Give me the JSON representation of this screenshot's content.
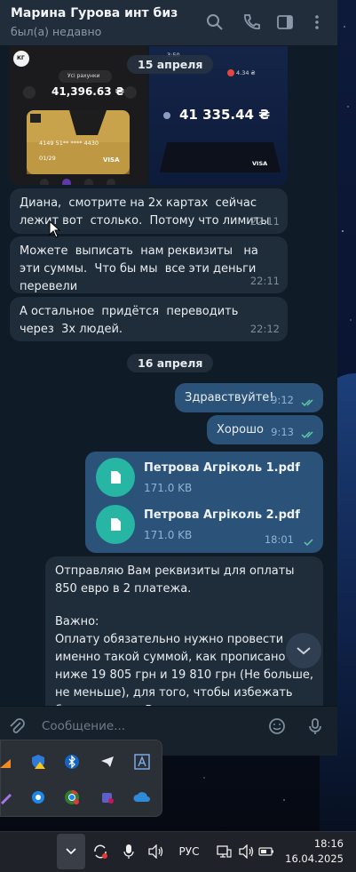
{
  "chat": {
    "contact_name": "Марина Гурова инт биз",
    "status": "был(а) недавно",
    "date_separator_1": "15 апреля",
    "date_separator_2": "16 апреля"
  },
  "images": {
    "left": {
      "bank_badge": "КГ",
      "account_pill": "Усі рахунки",
      "balance": "41,396.63 ₴",
      "card_number": "4149 51** **** 4430",
      "card_expiry": "01/29",
      "card_brand": "VISA"
    },
    "right": {
      "time": "3:50",
      "balance_small": "4.34 ₴",
      "balance": "41 335.44 ₴",
      "card_brand": "VISA"
    }
  },
  "messages": [
    {
      "text": "Диана,  смотрите на 2х картах  сейчас  лежит вот  столько.  Потому что лимиты",
      "time": "22:11"
    },
    {
      "text": "Можете  выписать  нам реквизиты   на эти суммы.  Что бы мы  все эти деньги  перевели",
      "time": "22:11"
    },
    {
      "text": "А остальное  придётся  переводить   через  3х людей.",
      "time": "22:12"
    },
    {
      "text": "Здравствуйте!",
      "time": "9:12"
    },
    {
      "text": "Хорошо",
      "time": "9:13"
    }
  ],
  "files": {
    "items": [
      {
        "name": "Петрова Агріколь 1.pdf",
        "size": "171.0 KB"
      },
      {
        "name": "Петрова Агріколь 2.pdf",
        "size": "171.0 KB"
      }
    ],
    "time": "18:01"
  },
  "long_message": {
    "line1": "Отправляю Вам реквизиты для оплаты 850 евро в 2 платежа.",
    "line2": "Важно:",
    "line3": "Оплату обязательно нужно провести именно такой суммой, как прописано ниже 19 805 грн и 19 810 грн (Не больше, не меньше), для того, чтобы избежать блокирования Ваш… или нашего счетов."
  },
  "composer": {
    "placeholder": "Сообщение..."
  },
  "taskbar": {
    "language": "РУС",
    "time": "18:16",
    "date": "16.04.2025"
  },
  "colors": {
    "header_bg": "#212d3b",
    "incoming_bubble": "#1f2c3a",
    "outgoing_bubble": "#2b5278",
    "file_icon": "#27b5a4",
    "read_ticks": "#5fc9a8"
  }
}
